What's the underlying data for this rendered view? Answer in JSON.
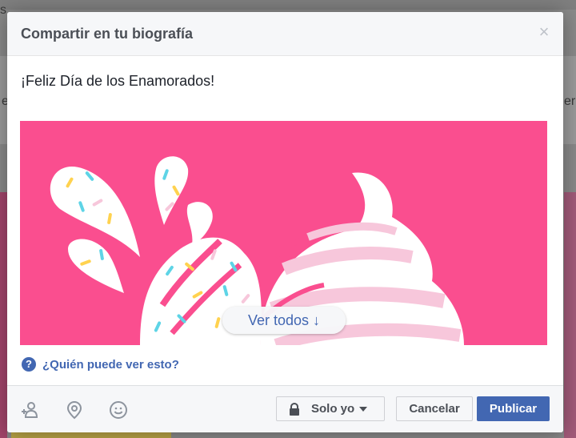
{
  "dialog": {
    "title": "Compartir en tu biografía",
    "close_label": "×"
  },
  "post": {
    "text": "¡Feliz Día de los Enamorados!",
    "media_button": "Ver todos ↓"
  },
  "privacy_help": {
    "icon_glyph": "?",
    "label": "¿Quién puede ver esto?"
  },
  "footer": {
    "icons": [
      "tag-friends-icon",
      "location-pin-icon",
      "feeling-smiley-icon"
    ],
    "audience_label": "Solo yo",
    "cancel_label": "Cancelar",
    "publish_label": "Publicar"
  },
  "background": {
    "fragments": [
      "s",
      "e",
      "eri"
    ]
  },
  "colors": {
    "accent": "#4267b2",
    "media_bg": "#fa4e8f",
    "header_bg": "#f6f7f9",
    "title_text": "#4b4f56"
  }
}
